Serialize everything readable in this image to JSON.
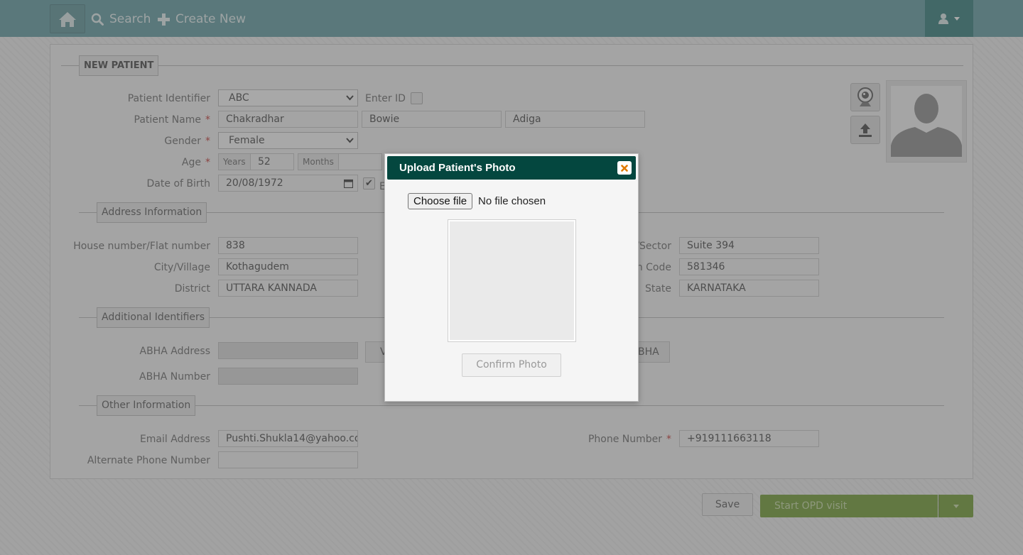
{
  "nav": {
    "search_label": "Search",
    "create_new_label": "Create New"
  },
  "form": {
    "title": "NEW PATIENT",
    "identifier": {
      "label": "Patient Identifier",
      "value": "ABC",
      "enter_id_label": "Enter ID"
    },
    "name": {
      "label": "Patient Name",
      "required": "*",
      "first": "Chakradhar",
      "middle": "Bowie",
      "last": "Adiga"
    },
    "gender": {
      "label": "Gender",
      "required": "*",
      "value": "Female"
    },
    "age": {
      "label": "Age",
      "required": "*",
      "years_label": "Years",
      "years_value": "52",
      "months_label": "Months",
      "months_value": ""
    },
    "dob": {
      "label": "Date of Birth",
      "value": "20/08/1972",
      "estimated_checked": true,
      "estimated_partial": "E"
    },
    "address": {
      "title": "Address Information",
      "house_label": "House number/Flat number",
      "house_value": "838",
      "city_label": "City/Village",
      "city_value": "Kothagudem",
      "district_label": "District",
      "district_value": "UTTARA KANNADA",
      "sector_label": "/Sector",
      "sector_value": "Suite 394",
      "pin_label": "n Code",
      "pin_value": "581346",
      "state_label": "State",
      "state_value": "KARNATAKA"
    },
    "additional": {
      "title": "Additional Identifiers",
      "abha_address_label": "ABHA Address",
      "abha_address_value": "",
      "abha_number_label": "ABHA Number",
      "abha_number_value": "",
      "verify_partial": "V",
      "abha_btn_partial": "BHA"
    },
    "other": {
      "title": "Other Information",
      "email_label": "Email Address",
      "email_value": "Pushti.Shukla14@yahoo.co",
      "phone_label": "Phone Number",
      "phone_required": "*",
      "phone_value": "+919111663118",
      "alt_phone_label": "Alternate Phone Number",
      "alt_phone_value": ""
    }
  },
  "actions": {
    "save_label": "Save",
    "start_opd_label": "Start OPD visit"
  },
  "modal": {
    "title": "Upload Patient's Photo",
    "choose_file_label": "Choose file",
    "no_file_label": "No file chosen",
    "confirm_label": "Confirm Photo"
  },
  "colors": {
    "topbar": "#5e9aa0",
    "modal_header": "#04473f",
    "opd_button": "#6f9b2e",
    "required": "#c0312d"
  }
}
